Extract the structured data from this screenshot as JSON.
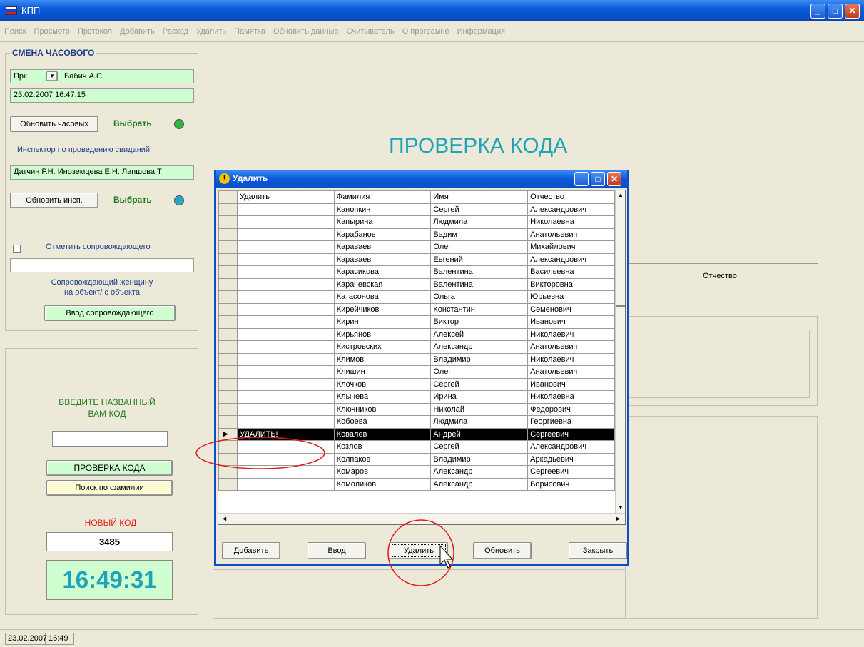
{
  "window": {
    "title": "КПП"
  },
  "menu": [
    "Поиск",
    "Просмотр",
    "Протокол",
    "Добавить",
    "Расход",
    "Удалить",
    "Памятка",
    "Обновить данные",
    "Считыватель",
    "О програмне",
    "Информация"
  ],
  "guard": {
    "title": "СМЕНА ЧАСОВОГО",
    "rank": "Прк",
    "name": "Бабич А.С.",
    "datetime": "23.02.2007 16:47:15",
    "refresh_label": "Обновить часовых",
    "select_label": "Выбрать",
    "inspector_label": "Инспектор по проведению свиданий",
    "inspectors": "Датчин Р.Н. Иноземцева Е.Н. Лапшова Т",
    "refresh_insp_label": "Обновить инсп.",
    "select_label2": "Выбрать",
    "mark_escort_label": "Отметить сопровождающего",
    "escort_desc_line1": "Сопровождающий женщину",
    "escort_desc_line2": "на объект/ с объекта",
    "escort_button": "Ввод сопровождающего"
  },
  "code": {
    "prompt_line1": "ВВЕДИТЕ НАЗВАННЫЙ",
    "prompt_line2": "ВАМ КОД",
    "check_button": "ПРОВЕРКА КОДА",
    "search_button": "Поиск по фамилии",
    "new_code_label": "НОВЫЙ КОД",
    "new_code_value": "3485",
    "clock": "16:49:31"
  },
  "main": {
    "heading": "ПРОВЕРКА КОДА",
    "patronymic_col": "Отчество"
  },
  "statusbar": {
    "date": "23.02.2007",
    "time": "16:49"
  },
  "dialog": {
    "title": "Удалить",
    "columns": [
      "Удалить",
      "Фамилия",
      "Имя",
      "Отчество"
    ],
    "rows": [
      [
        "",
        "Канопкин",
        "Сергей",
        "Александрович"
      ],
      [
        "",
        "Капырина",
        "Людмила",
        "Николаевна"
      ],
      [
        "",
        "Карабанов",
        "Вадим",
        "Анатольевич"
      ],
      [
        "",
        "Караваев",
        "Олег",
        "Михайлович"
      ],
      [
        "",
        "Караваев",
        "Евгений",
        "Александрович"
      ],
      [
        "",
        "Карасикова",
        "Валентина",
        "Васильевна"
      ],
      [
        "",
        "Карачевская",
        "Валентина",
        "Викторовна"
      ],
      [
        "",
        "Катасонова",
        "Ольга",
        "Юрьевна"
      ],
      [
        "",
        "Кирейчиков",
        "Константин",
        "Семенович"
      ],
      [
        "",
        "Кирин",
        "Виктор",
        "Иванович"
      ],
      [
        "",
        "Кирьянов",
        "Алексей",
        "Николаевич"
      ],
      [
        "",
        "Кистровских",
        "Александр",
        "Анатольевич"
      ],
      [
        "",
        "Климов",
        "Владимир",
        "Николаевич"
      ],
      [
        "",
        "Клишин",
        "Олег",
        "Анатольевич"
      ],
      [
        "",
        "Клочков",
        "Сергей",
        "Иванович"
      ],
      [
        "",
        "Клычева",
        "Ирина",
        "Николаевна"
      ],
      [
        "",
        "Ключников",
        "Николай",
        "Федорович"
      ],
      [
        "",
        "Кобоева",
        "Людмила",
        "Георгиевна"
      ],
      [
        "УДАЛИТЬ!",
        "Ковалев",
        "Андрей",
        "Сергеевич"
      ],
      [
        "",
        "Козлов",
        "Сергей",
        "Александрович"
      ],
      [
        "",
        "Колпаков",
        "Владимир",
        "Аркадьевич"
      ],
      [
        "",
        "Комаров",
        "Александр",
        "Сергеевич"
      ],
      [
        "",
        "Комоликов",
        "Александр",
        "Борисович"
      ]
    ],
    "selected_index": 18,
    "buttons": [
      "Добавить",
      "Ввод",
      "Удалить",
      "Обновить",
      "Закрыть"
    ]
  }
}
